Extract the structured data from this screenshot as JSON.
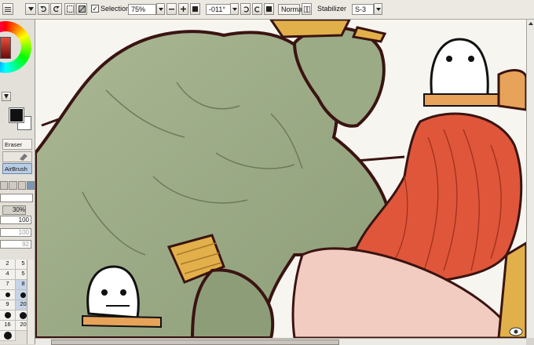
{
  "toolbar": {
    "selection_label": "Selection",
    "selection_checked": "✓",
    "zoom_value": "75%",
    "rotation_value": "-011°",
    "blend_mode": "Normal",
    "stabilizer_label": "Stabilizer",
    "stabilizer_value": "S-3"
  },
  "tools": {
    "items": [
      {
        "label": "Eraser"
      },
      {
        "label": "AirBrush"
      }
    ]
  },
  "brush": {
    "density_pct": "30%",
    "val_a": "100",
    "val_b": "100",
    "val_c": "92"
  },
  "sizes": {
    "row1": [
      "2",
      "5"
    ],
    "row2": [
      "4",
      "5"
    ],
    "row3": [
      "7",
      "8"
    ],
    "row4": [
      "9",
      "20"
    ],
    "row5": [
      "16",
      "20"
    ]
  },
  "scroll": {
    "horizontal_position": 0.1
  },
  "colors": {
    "skin_green": "#9eae87",
    "outline": "#3a1411",
    "hair_orange": "#e0563a",
    "gold": "#e2b04a",
    "accent_blue": "#3a6bc6"
  }
}
